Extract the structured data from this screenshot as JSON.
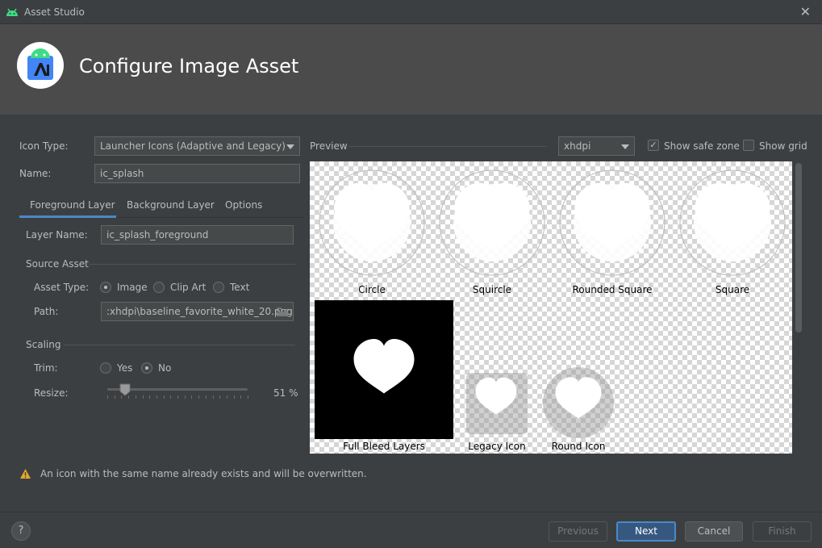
{
  "window": {
    "title": "Asset Studio",
    "close_icon": "close-icon"
  },
  "header": {
    "heading": "Configure Image Asset"
  },
  "form": {
    "icon_type_label": "Icon Type:",
    "icon_type_value": "Launcher Icons (Adaptive and Legacy)",
    "name_label": "Name:",
    "name_value": "ic_splash",
    "tabs": [
      "Foreground Layer",
      "Background Layer",
      "Options"
    ],
    "layer_name_label": "Layer Name:",
    "layer_name_value": "ic_splash_foreground",
    "source_asset_label": "Source Asset",
    "asset_type_label": "Asset Type:",
    "asset_type_options": [
      "Image",
      "Clip Art",
      "Text"
    ],
    "asset_type_selected": "Image",
    "path_label": "Path:",
    "path_value": ":xhdpi\\baseline_favorite_white_20.png",
    "scaling_label": "Scaling",
    "trim_label": "Trim:",
    "trim_options": [
      "Yes",
      "No"
    ],
    "trim_selected": "No",
    "resize_label": "Resize:",
    "resize_value": 51,
    "resize_text": "51 %"
  },
  "preview": {
    "label": "Preview",
    "density_value": "xhdpi",
    "show_safe_zone_label": "Show safe zone",
    "show_safe_zone_checked": true,
    "show_grid_label": "Show grid",
    "show_grid_checked": false,
    "captions": [
      "Circle",
      "Squircle",
      "Rounded Square",
      "Square",
      "Full Bleed Layers",
      "Legacy Icon",
      "Round Icon"
    ]
  },
  "warning": {
    "text": "An icon with the same name already exists and will be overwritten."
  },
  "footer": {
    "help_label": "?",
    "previous_label": "Previous",
    "next_label": "Next",
    "cancel_label": "Cancel",
    "finish_label": "Finish"
  },
  "colors": {
    "accent": "#4a88c7",
    "primary_button": "#365880",
    "warning": "#e0a82e",
    "android_green": "#3ddc84"
  }
}
